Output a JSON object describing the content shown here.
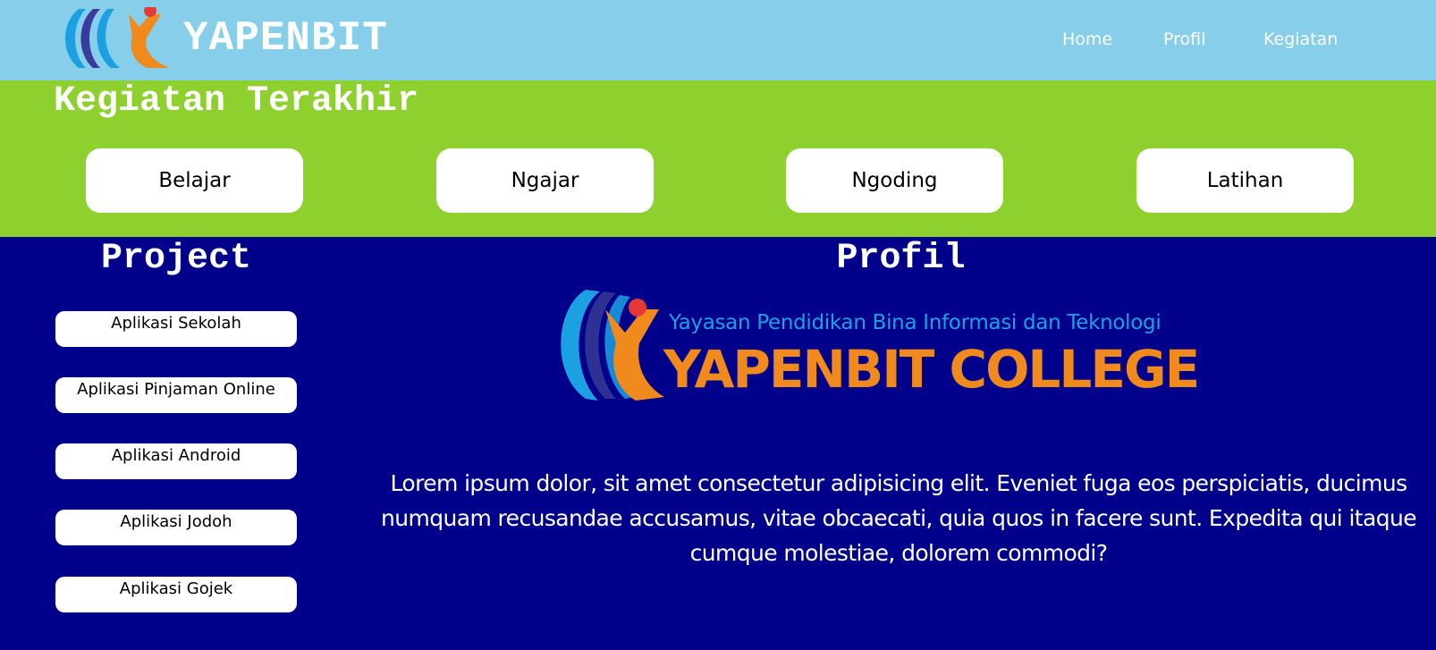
{
  "header": {
    "brand": "YAPENBIT",
    "nav": [
      {
        "label": "Home"
      },
      {
        "label": "Profil"
      },
      {
        "label": "Kegiatan"
      }
    ]
  },
  "kegiatan": {
    "title": "Kegiatan Terakhir",
    "items": [
      {
        "label": "Belajar"
      },
      {
        "label": "Ngajar"
      },
      {
        "label": "Ngoding"
      },
      {
        "label": "Latihan"
      }
    ]
  },
  "project": {
    "title": "Project",
    "items": [
      {
        "label": "Aplikasi Sekolah"
      },
      {
        "label": "Aplikasi Pinjaman Online"
      },
      {
        "label": "Aplikasi Android"
      },
      {
        "label": "Aplikasi Jodoh"
      },
      {
        "label": "Aplikasi Gojek"
      }
    ]
  },
  "profil": {
    "title": "Profil",
    "logo_subtitle": "Yayasan Pendidikan Bina Informasi dan Teknologi",
    "logo_name": "YAPENBIT COLLEGE",
    "description": "Lorem ipsum dolor, sit amet consectetur adipisicing elit. Eveniet fuga eos perspiciatis, ducimus numquam recusandae accusamus, vitae obcaecati, quia quos in facere sunt. Expedita qui itaque cumque molestiae, dolorem commodi?"
  },
  "colors": {
    "header_bg": "#87ceeb",
    "band_bg": "#8ed12f",
    "body_bg": "#00008b",
    "logo_orange": "#f08a1c",
    "logo_blue": "#1ba1e2"
  }
}
